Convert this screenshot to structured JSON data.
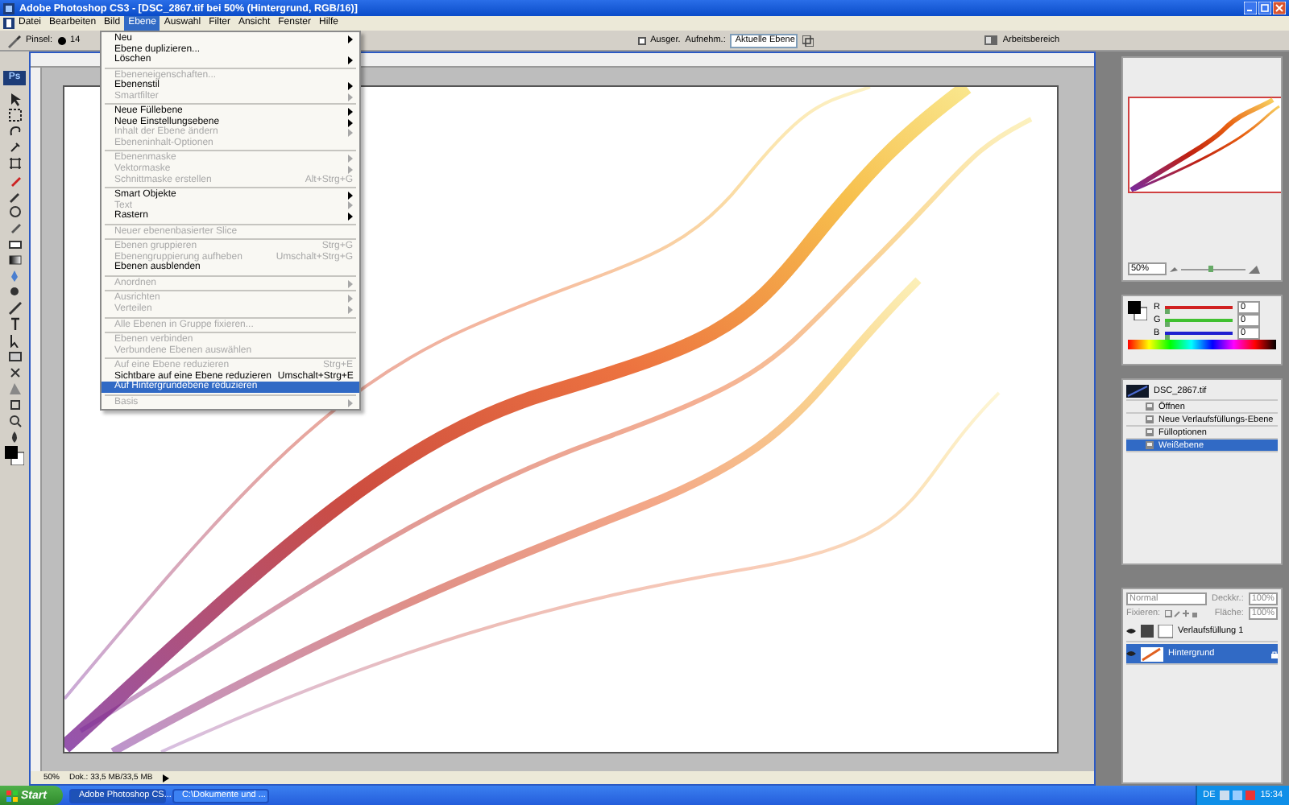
{
  "window": {
    "title": "Adobe Photoshop CS3 - [DSC_2867.tif bei 50% (Hintergrund, RGB/16)]"
  },
  "menu_bar": [
    {
      "label": "Datei",
      "selected": false
    },
    {
      "label": "Bearbeiten",
      "selected": false
    },
    {
      "label": "Bild",
      "selected": false
    },
    {
      "label": "Ebene",
      "selected": true
    },
    {
      "label": "Auswahl",
      "selected": false
    },
    {
      "label": "Filter",
      "selected": false
    },
    {
      "label": "Ansicht",
      "selected": false
    },
    {
      "label": "Fenster",
      "selected": false
    },
    {
      "label": "Hilfe",
      "selected": false
    }
  ],
  "options_bar": {
    "brush_label": "Pinsel:",
    "brush_size": "14",
    "align_label": "Ausger.",
    "align_checked": false,
    "sample_label": "Aufnehm.:",
    "sample_value": "Aktuelle Ebene",
    "workspace": "Arbeitsbereich"
  },
  "toolbox": {
    "logo": "Ps"
  },
  "menu": {
    "items": [
      {
        "kind": "item",
        "label": "Neu",
        "submenu": true,
        "disabled": false,
        "selected": false
      },
      {
        "kind": "item",
        "label": "Ebene duplizieren...",
        "submenu": false,
        "disabled": false,
        "selected": false
      },
      {
        "kind": "item",
        "label": "Löschen",
        "submenu": true,
        "disabled": false,
        "selected": false
      },
      {
        "kind": "separator"
      },
      {
        "kind": "item",
        "label": "Ebeneneigenschaften...",
        "submenu": false,
        "disabled": true,
        "selected": false
      },
      {
        "kind": "item",
        "label": "Ebenenstil",
        "submenu": true,
        "disabled": false,
        "selected": false
      },
      {
        "kind": "item",
        "label": "Smartfilter",
        "submenu": true,
        "disabled": true,
        "selected": false
      },
      {
        "kind": "separator"
      },
      {
        "kind": "item",
        "label": "Neue Füllebene",
        "submenu": true,
        "disabled": false,
        "selected": false
      },
      {
        "kind": "item",
        "label": "Neue Einstellungsebene",
        "submenu": true,
        "disabled": false,
        "selected": false
      },
      {
        "kind": "item",
        "label": "Inhalt der Ebene ändern",
        "submenu": true,
        "disabled": true,
        "selected": false
      },
      {
        "kind": "item",
        "label": "Ebeneninhalt-Optionen",
        "submenu": false,
        "disabled": true,
        "selected": false
      },
      {
        "kind": "separator"
      },
      {
        "kind": "item",
        "label": "Ebenenmaske",
        "submenu": true,
        "disabled": true,
        "selected": false
      },
      {
        "kind": "item",
        "label": "Vektormaske",
        "submenu": true,
        "disabled": true,
        "selected": false
      },
      {
        "kind": "item",
        "label": "Schnittmaske erstellen",
        "shortcut": "Alt+Strg+G",
        "submenu": false,
        "disabled": true,
        "selected": false
      },
      {
        "kind": "separator"
      },
      {
        "kind": "item",
        "label": "Smart Objekte",
        "submenu": true,
        "disabled": false,
        "selected": false
      },
      {
        "kind": "item",
        "label": "Text",
        "submenu": true,
        "disabled": true,
        "selected": false
      },
      {
        "kind": "item",
        "label": "Rastern",
        "submenu": true,
        "disabled": false,
        "selected": false
      },
      {
        "kind": "separator"
      },
      {
        "kind": "item",
        "label": "Neuer ebenenbasierter Slice",
        "submenu": false,
        "disabled": true,
        "selected": false
      },
      {
        "kind": "separator"
      },
      {
        "kind": "item",
        "label": "Ebenen gruppieren",
        "shortcut": "Strg+G",
        "submenu": false,
        "disabled": true,
        "selected": false
      },
      {
        "kind": "item",
        "label": "Ebenengruppierung aufheben",
        "shortcut": "Umschalt+Strg+G",
        "submenu": false,
        "disabled": true,
        "selected": false
      },
      {
        "kind": "item",
        "label": "Ebenen ausblenden",
        "submenu": false,
        "disabled": false,
        "selected": false
      },
      {
        "kind": "separator"
      },
      {
        "kind": "item",
        "label": "Anordnen",
        "submenu": true,
        "disabled": true,
        "selected": false
      },
      {
        "kind": "separator"
      },
      {
        "kind": "item",
        "label": "Ausrichten",
        "submenu": true,
        "disabled": true,
        "selected": false
      },
      {
        "kind": "item",
        "label": "Verteilen",
        "submenu": true,
        "disabled": true,
        "selected": false
      },
      {
        "kind": "separator"
      },
      {
        "kind": "item",
        "label": "Alle Ebenen in Gruppe fixieren...",
        "submenu": false,
        "disabled": true,
        "selected": false
      },
      {
        "kind": "separator"
      },
      {
        "kind": "item",
        "label": "Ebenen verbinden",
        "submenu": false,
        "disabled": true,
        "selected": false
      },
      {
        "kind": "item",
        "label": "Verbundene Ebenen auswählen",
        "submenu": false,
        "disabled": true,
        "selected": false
      },
      {
        "kind": "separator"
      },
      {
        "kind": "item",
        "label": "Auf eine Ebene reduzieren",
        "shortcut": "Strg+E",
        "submenu": false,
        "disabled": true,
        "selected": false
      },
      {
        "kind": "item",
        "label": "Sichtbare auf eine Ebene reduzieren",
        "shortcut": "Umschalt+Strg+E",
        "submenu": false,
        "disabled": false,
        "selected": false
      },
      {
        "kind": "item",
        "label": "Auf Hintergrundebene reduzieren",
        "submenu": false,
        "disabled": false,
        "selected": true
      },
      {
        "kind": "separator"
      },
      {
        "kind": "item",
        "label": "Basis",
        "submenu": true,
        "disabled": true,
        "selected": false
      }
    ]
  },
  "document": {
    "zoom": "50%",
    "doc_size": "Dok.: 33,5 MB/33,5 MB"
  },
  "navigator": {
    "zoom": "50%",
    "level": 0.45
  },
  "color": {
    "channels": [
      {
        "name": "R",
        "value": "0",
        "level": 0,
        "color": "#d02020"
      },
      {
        "name": "G",
        "value": "0",
        "level": 0,
        "color": "#40c030"
      },
      {
        "name": "B",
        "value": "0",
        "level": 0,
        "color": "#2020d0"
      }
    ]
  },
  "history": {
    "snapshot": "DSC_2867.tif",
    "items": [
      {
        "label": "Öffnen",
        "selected": false
      },
      {
        "label": "Neue Verlaufsfüllungs-Ebene",
        "selected": false
      },
      {
        "label": "Fülloptionen",
        "selected": false
      },
      {
        "label": "Weißebene",
        "selected": true
      }
    ]
  },
  "layers": {
    "blend_mode": "Normal",
    "opacity_label": "Deckkr.:",
    "opacity": "100%",
    "lock_label": "Fixieren:",
    "fill_label": "Fläche:",
    "fill": "100%",
    "items": [
      {
        "name": "Verlaufsfüllung 1",
        "kind": "adjustment",
        "selected": false
      },
      {
        "name": "Hintergrund",
        "kind": "image",
        "selected": true
      }
    ]
  },
  "taskbar": {
    "start": "Start",
    "tasks": [
      {
        "label": "Adobe Photoshop CS...",
        "selected": true
      },
      {
        "label": "C:\\Dokumente und ...",
        "selected": false
      }
    ],
    "language": "DE",
    "clock": "15:34"
  }
}
